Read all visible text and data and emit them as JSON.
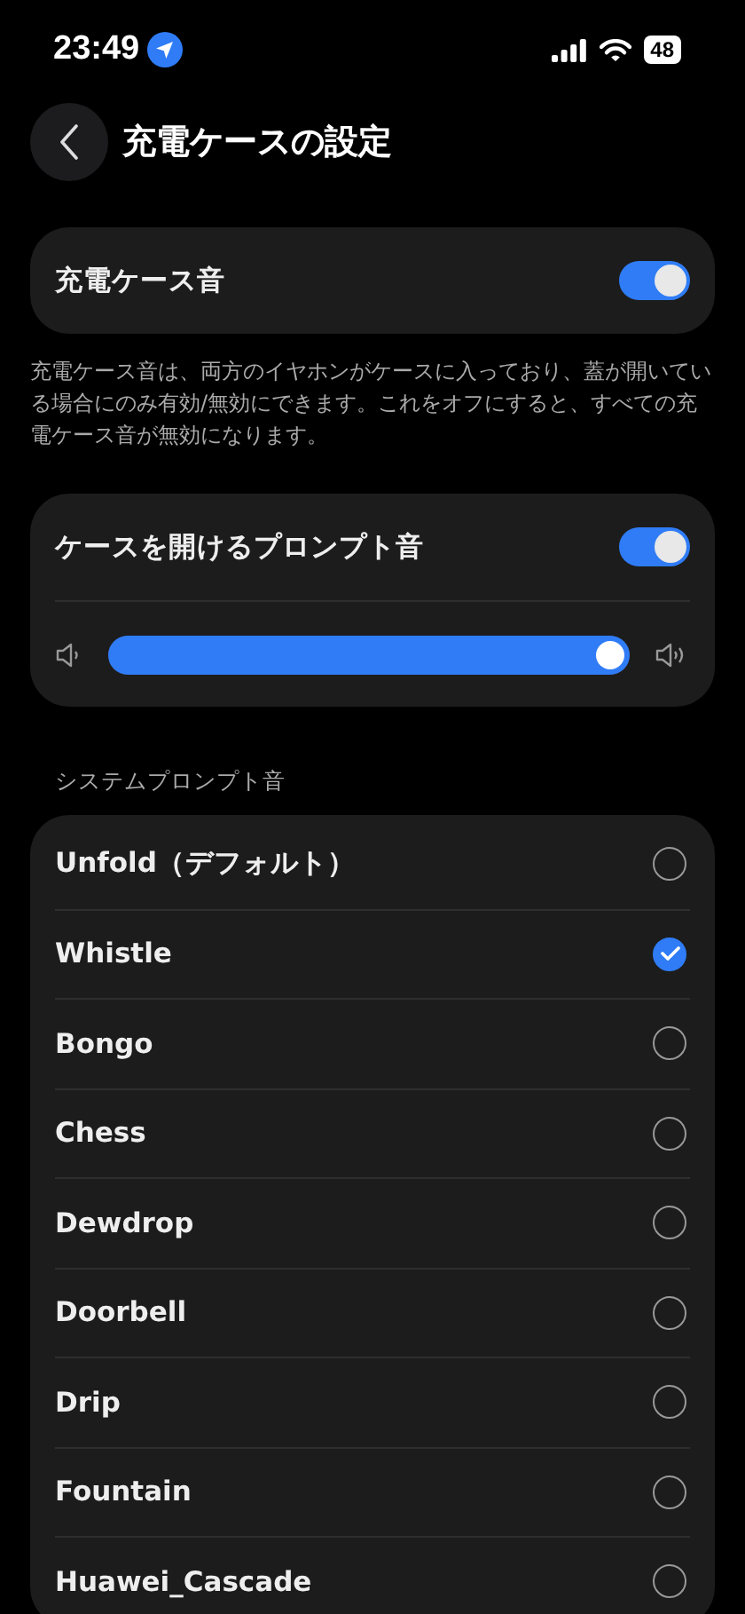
{
  "status_bar": {
    "time": "23:49",
    "battery": "48"
  },
  "header": {
    "title": "充電ケースの設定"
  },
  "case_sound": {
    "label": "充電ケース音",
    "on": true
  },
  "description": "充電ケース音は、両方のイヤホンがケースに入っており、蓋が開いている場合にのみ有効/無効にできます。これをオフにすると、すべての充電ケース音が無効になります。",
  "open_prompt": {
    "label": "ケースを開けるプロンプト音",
    "on": true,
    "volume": {
      "level": 1.0
    }
  },
  "section_title": "システムプロンプト音",
  "sounds": [
    {
      "label": "Unfold（デフォルト）",
      "selected": false
    },
    {
      "label": "Whistle",
      "selected": true
    },
    {
      "label": "Bongo",
      "selected": false
    },
    {
      "label": "Chess",
      "selected": false
    },
    {
      "label": "Dewdrop",
      "selected": false
    },
    {
      "label": "Doorbell",
      "selected": false
    },
    {
      "label": "Drip",
      "selected": false
    },
    {
      "label": "Fountain",
      "selected": false
    },
    {
      "label": "Huawei_Cascade",
      "selected": false
    }
  ]
}
